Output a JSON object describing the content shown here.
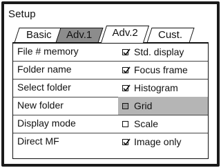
{
  "menu": {
    "title": "Setup",
    "tabs": [
      {
        "label": "Basic",
        "active": false
      },
      {
        "label": "Adv.1",
        "active": true
      },
      {
        "label": "Adv.2",
        "active": false
      },
      {
        "label": "Cust.",
        "active": false
      }
    ],
    "left_items": [
      "File # memory",
      "Folder name",
      "Select folder",
      "New folder",
      "Display mode",
      "Direct MF"
    ],
    "options": [
      {
        "label": "Std. display",
        "checked": true,
        "selected": false
      },
      {
        "label": "Focus frame",
        "checked": true,
        "selected": false
      },
      {
        "label": "Histogram",
        "checked": true,
        "selected": false
      },
      {
        "label": "Grid",
        "checked": false,
        "selected": true
      },
      {
        "label": "Scale",
        "checked": false,
        "selected": false
      },
      {
        "label": "Image only",
        "checked": true,
        "selected": false
      }
    ]
  },
  "colors": {
    "screen_bg": "#1a1a1a",
    "panel_bg": "#ffffff",
    "active_tab": "#8c8c8c",
    "highlight_row": "#b5b5b5"
  }
}
